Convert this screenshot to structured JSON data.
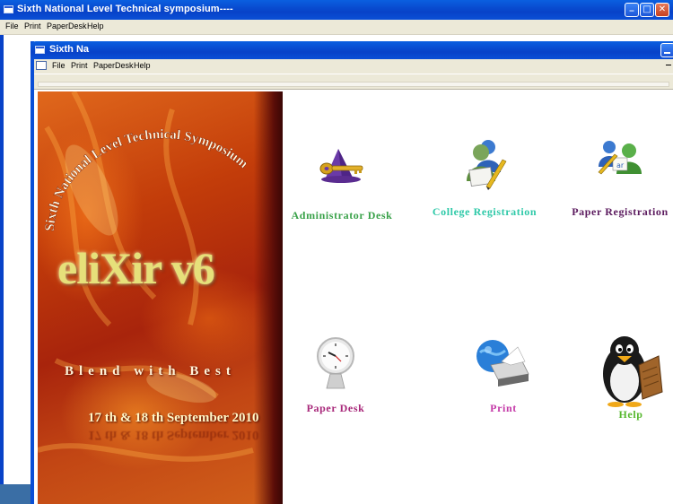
{
  "outer_window": {
    "title": "Sixth National Level Technical symposium----",
    "controls": {
      "minimize": "_",
      "maximize": "□",
      "close": "✕"
    },
    "menu": [
      "File",
      "Print",
      "PaperDesk",
      "Help"
    ]
  },
  "inner_window": {
    "title": "Sixth Na",
    "menu": [
      "File",
      "Print",
      "PaperDesk",
      "Help"
    ]
  },
  "banner": {
    "arc_text": "Sixth National Level Technical Symposium",
    "logo": "eliXir v6",
    "tagline": "Blend with Best",
    "date": "17 th & 18 th September  2010"
  },
  "tiles": [
    {
      "label": "Administrator Desk",
      "color": "#3aa24a",
      "icon": "admin-key-icon"
    },
    {
      "label": "College Registration",
      "color": "#2ec9a8",
      "icon": "user-edit-icon"
    },
    {
      "label": "Paper  Registration",
      "color": "#5b1a5e",
      "icon": "users-group-icon"
    },
    {
      "label": "Paper Desk",
      "color": "#a8287a",
      "icon": "clock-icon"
    },
    {
      "label": "Print",
      "color": "#c43aa8",
      "icon": "printer-icon"
    },
    {
      "label": "Help",
      "color": "#56b82e",
      "icon": "penguin-icon"
    }
  ]
}
